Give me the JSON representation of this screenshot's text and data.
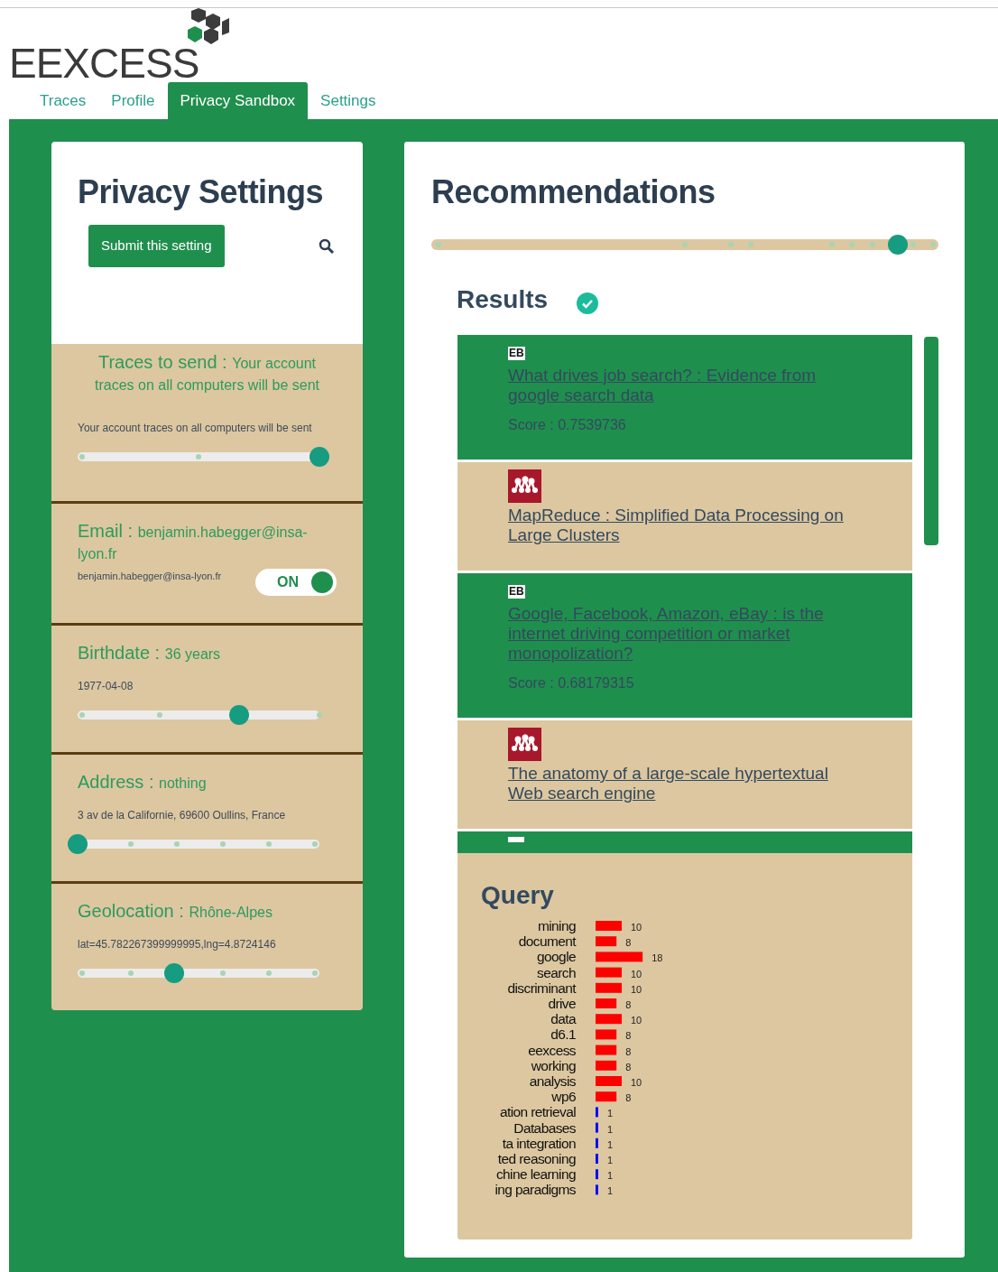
{
  "logo": "EEXCESS",
  "tabs": [
    {
      "label": "Traces",
      "selected": false
    },
    {
      "label": "Profile",
      "selected": false
    },
    {
      "label": "Privacy Sandbox",
      "selected": true
    },
    {
      "label": "Settings",
      "selected": false
    }
  ],
  "privacy": {
    "title": "Privacy Settings",
    "submit_button": "Submit this setting",
    "sections": [
      {
        "kind": "slider",
        "label": "Traces to send :",
        "value": "Your account traces on all computers will be sent",
        "detail": "Your account traces on all computers will be sent",
        "level": 1
      },
      {
        "kind": "toggle",
        "label": "Email :",
        "value": "benjamin.habegger@insa-lyon.fr",
        "detail": "benjamin.habegger@insa-lyon.fr",
        "toggle_label": "ON",
        "on": true
      },
      {
        "kind": "slider",
        "label": "Birthdate :",
        "value": "36 years",
        "detail": "1977-04-08",
        "level": 0.667
      },
      {
        "kind": "slider",
        "label": "Address :",
        "value": "nothing",
        "detail": "3 av de la Californie, 69600 Oullins, France",
        "level": 0
      },
      {
        "kind": "slider",
        "label": "Geolocation :",
        "value": "Rhône-Alpes",
        "detail": "lat=45.782267399999995,lng=4.8724146",
        "level": 0.4
      }
    ]
  },
  "recommendations": {
    "title": "Recommendations",
    "slider": {
      "level": 0.92
    },
    "results_title": "Results",
    "results": [
      {
        "kind": "eb",
        "source_label": "EB",
        "title": "What drives job search? : Evidence from google search data",
        "score": "Score : 0.7539736"
      },
      {
        "kind": "logo",
        "title": "MapReduce : Simplified Data Processing on Large Clusters"
      },
      {
        "kind": "eb",
        "source_label": "EB",
        "title": "Google, Facebook, Amazon, eBay : is the internet driving competition or market monopolization?",
        "score": "Score : 0.68179315"
      },
      {
        "kind": "logo",
        "title": "The anatomy of a large-scale hypertextual Web search engine"
      },
      {
        "kind": "eb"
      }
    ],
    "query": {
      "title": "Query",
      "chart_data": {
        "type": "bar",
        "orientation": "horizontal",
        "data_labels": true,
        "categories": [
          "mining",
          "document",
          "google",
          "search",
          "discriminant",
          "drive",
          "data",
          "d6.1",
          "eexcess",
          "working",
          "analysis",
          "wp6",
          "ation retrieval",
          "Databases",
          "ta integration",
          "ted reasoning",
          "chine learning",
          "ing paradigms"
        ],
        "series": [
          {
            "color": "#ff0000",
            "values": [
              10,
              8,
              18,
              10,
              10,
              8,
              10,
              8,
              8,
              8,
              10,
              8,
              null,
              null,
              null,
              null,
              null,
              null
            ]
          },
          {
            "color": "#0000ff",
            "values": [
              null,
              null,
              null,
              null,
              null,
              null,
              null,
              null,
              null,
              null,
              null,
              null,
              1,
              1,
              1,
              1,
              1,
              1
            ]
          }
        ]
      }
    }
  }
}
